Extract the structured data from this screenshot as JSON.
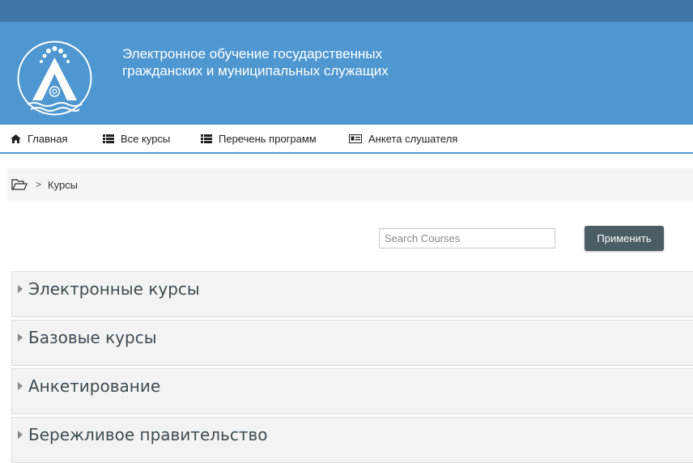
{
  "header": {
    "site_title": "Электронное обучение государственных гражданских и муниципальных служащих",
    "logo_icon": "emblem-logo"
  },
  "nav": {
    "items": [
      {
        "label": "Главная",
        "icon": "home-icon"
      },
      {
        "label": "Все курсы",
        "icon": "list-icon"
      },
      {
        "label": "Перечень программ",
        "icon": "list-icon"
      },
      {
        "label": "Анкета слушателя",
        "icon": "id-card-icon"
      }
    ]
  },
  "breadcrumb": {
    "icon": "folder-open-icon",
    "separator": ">",
    "current": "Курсы"
  },
  "search": {
    "placeholder": "Search Courses",
    "value": "",
    "button_label": "Применить"
  },
  "categories": [
    {
      "title": "Электронные курсы"
    },
    {
      "title": "Базовые курсы"
    },
    {
      "title": "Анкетирование"
    },
    {
      "title": "Бережливое правительство"
    }
  ],
  "colors": {
    "topbar": "#3f78a8",
    "banner": "#4f97d1",
    "button": "#4a5d65",
    "category_bg": "#f3f3f3"
  }
}
